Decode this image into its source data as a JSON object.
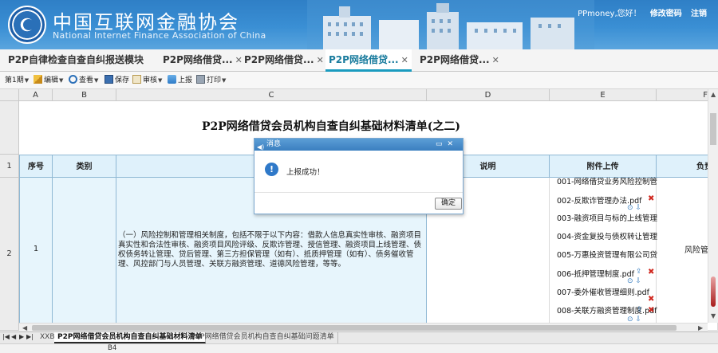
{
  "header": {
    "cn_title": "中国互联网金融协会",
    "en_title": "National Internet Finance Association of China",
    "greeting": "PPmoney,您好！",
    "change_password": "修改密码",
    "logout": "注销"
  },
  "tabs": [
    {
      "label": "P2P自律检查自查自纠报送模块",
      "closable": false
    },
    {
      "label": "P2P网络借贷...",
      "closable": true
    },
    {
      "label": "P2P网络借贷...",
      "closable": true
    },
    {
      "label": "P2P网络借贷...",
      "closable": true,
      "active": true
    },
    {
      "label": "P2P网络借贷...",
      "closable": true
    }
  ],
  "toolbar": {
    "period": "第1期",
    "edit": "编辑",
    "view": "查看",
    "save": "保存",
    "review": "审核",
    "submit": "上报",
    "print": "打印"
  },
  "sheet": {
    "columns": [
      "A",
      "B",
      "C",
      "D",
      "E",
      "F"
    ],
    "rows": [
      "1",
      "2"
    ],
    "title": "P2P网络借贷会员机构自查自纠基础材料清单(之二)",
    "headers": {
      "seq": "序号",
      "category": "类别",
      "description": "说明",
      "attachments": "附件上传",
      "responsible": "负责"
    },
    "row2": {
      "seq": "1",
      "content": "（一）风险控制和管理相关制度，包括不限于以下内容：借款人信息真实性审核、融资项目真实性和合法性审核、融资项目风险评级、反欺诈管理、授信管理、融资项目上线管理、债权债务转让管理、贷后管理、第三方担保管理（如有）、抵质押管理（如有）、债务催收管理、风控部门与人员管理、关联方融资管理、道德风险管理，等等。",
      "responsible": "风险管"
    },
    "attachments": [
      "001-网络借贷业务风险控制管",
      "002-反欺诈管理办法.pdf",
      "003-融资项目与标的上线管理",
      "004-资金复投与债权转让管理",
      "005-万惠投资管理有限公司贷",
      "006-抵押管理制度.pdf",
      "007-委外催收管理细则.pdf",
      "008-关联方融资管理制度.pdf"
    ]
  },
  "sheet_tabs": [
    {
      "label": "XXB"
    },
    {
      "label": "P2P网络借贷会员机构自查自纠基础材料清单",
      "active": true
    },
    {
      "label": "P2P网络借贷会员机构自查自纠基础问题清单"
    }
  ],
  "status": {
    "cell_ref": "B4"
  },
  "dialog": {
    "title": "消息",
    "message": "上报成功！",
    "ok": "确定"
  },
  "colors": {
    "accent": "#1a9bbf",
    "header_blue": "#3a8fd4",
    "delete_red": "#d0281f"
  }
}
